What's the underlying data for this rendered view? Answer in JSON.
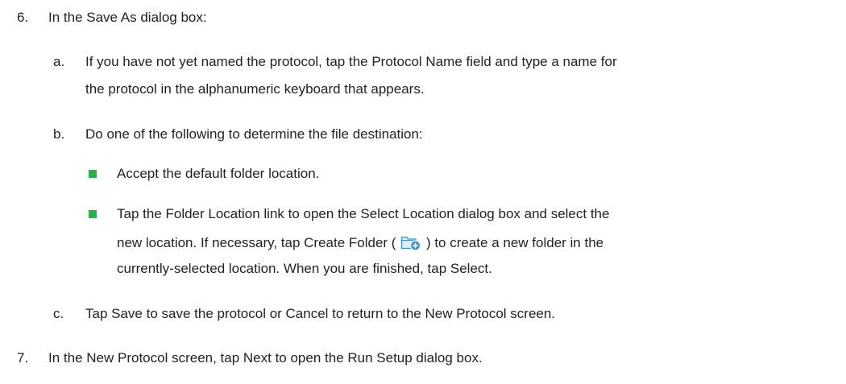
{
  "step6": {
    "number": "6.",
    "text": "In the Save As dialog box:",
    "sub_a": {
      "marker": "a.",
      "line1": "If you have not yet named the protocol, tap the Protocol Name field and type a name for",
      "line2": "the protocol in the alphanumeric keyboard that appears."
    },
    "sub_b": {
      "marker": "b.",
      "text": "Do one of the following to determine the file destination:",
      "bullet1": "Accept the default folder location.",
      "bullet2": {
        "line1": "Tap the Folder Location link to open the Select Location dialog box and select the",
        "line2_before_icon": "new location. If necessary, tap Create Folder (",
        "line2_after_icon": ") to create a new folder in the",
        "line3": "currently-selected location. When you are finished, tap Select."
      }
    },
    "sub_c": {
      "marker": "c.",
      "text": "Tap Save to save the protocol or Cancel to return to the New Protocol screen."
    }
  },
  "step7": {
    "number": "7.",
    "text": "In the New Protocol screen, tap Next to open the Run Setup dialog box."
  },
  "bullet_color": "#2ab24a",
  "create_folder_icon": "create-folder-icon"
}
